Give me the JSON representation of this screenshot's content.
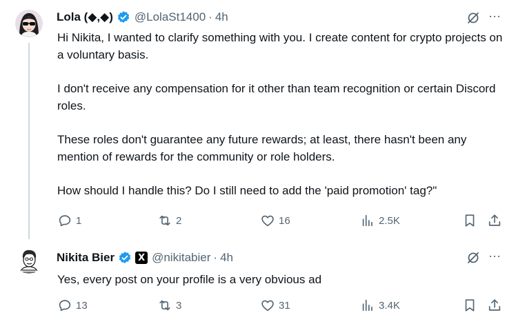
{
  "tweets": [
    {
      "name": "Lola (◆,◆)",
      "handle": "@LolaSt1400",
      "separator": "·",
      "time": "4h",
      "more": "···",
      "paragraphs": [
        "Hi Nikita, I wanted to clarify something with you. I create content for crypto projects on a voluntary basis.",
        "I don't receive any compensation for it other than team recognition or certain Discord roles.",
        "These roles don't guarantee any future rewards; at least, there hasn't been any mention of rewards for the community or role holders.",
        "How should I handle this? Do I still need to add the 'paid promotion' tag?\""
      ],
      "stats": {
        "replies": "1",
        "reposts": "2",
        "likes": "16",
        "views": "2.5K"
      }
    },
    {
      "name": "Nikita Bier",
      "badge": "X",
      "handle": "@nikitabier",
      "separator": "·",
      "time": "4h",
      "more": "···",
      "text": "Yes, every post on your profile is a very obvious ad",
      "stats": {
        "replies": "13",
        "reposts": "3",
        "likes": "31",
        "views": "3.4K"
      }
    }
  ],
  "colors": {
    "verified": "#1d9bf0",
    "secondary_text": "#536471",
    "thread_line": "#cfd9de"
  }
}
